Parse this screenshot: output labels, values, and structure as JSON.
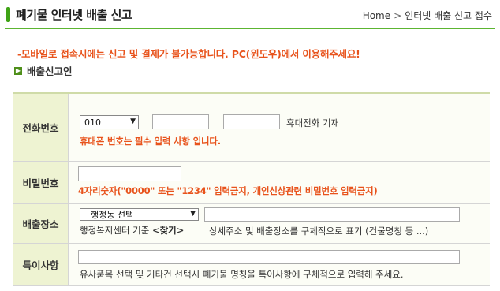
{
  "header": {
    "title": "폐기물 인터넷 배출 신고",
    "breadcrumb": {
      "home": "Home",
      "separator": ">",
      "current": "인터넷 배출 신고 접수"
    }
  },
  "notice": "-모바일로 접속시에는 신고 및 결제가 불가능합니다. PC(윈도우)에서 이용해주세요!",
  "section": {
    "title": "배출신고인",
    "icon": "bullet-arrow-icon"
  },
  "form": {
    "phone": {
      "label": "전화번호",
      "prefix_selected": "010",
      "middle_value": "",
      "last_value": "",
      "dash": "-",
      "hint": "휴대전화 기재",
      "warning": "휴대폰 번호는 필수 입력 사항 입니다."
    },
    "password": {
      "label": "비밀번호",
      "value": "",
      "warning": "4자리숫자(\"0000\" 또는 \"1234\" 입력금지, 개인신상관련 비밀번호 입력금지)"
    },
    "location": {
      "label": "배출장소",
      "district_selected": "행정동 선택",
      "detail_value": "",
      "district_hint_prefix": "행정복지센터 기준 ",
      "find_label": "<찾기>",
      "detail_hint": "상세주소 및 배출장소를 구체적으로 표기 (건물명칭 등 ...)"
    },
    "remarks": {
      "label": "특이사항",
      "value": "",
      "hint": "유사품목 선택 및 기타건 선택시 폐기물 명칭을 특이사항에 구체적으로 입력해 주세요."
    }
  },
  "colors": {
    "accent_green": "#5cb531",
    "warning_orange": "#e8531c",
    "label_bg": "#eef3d2"
  }
}
